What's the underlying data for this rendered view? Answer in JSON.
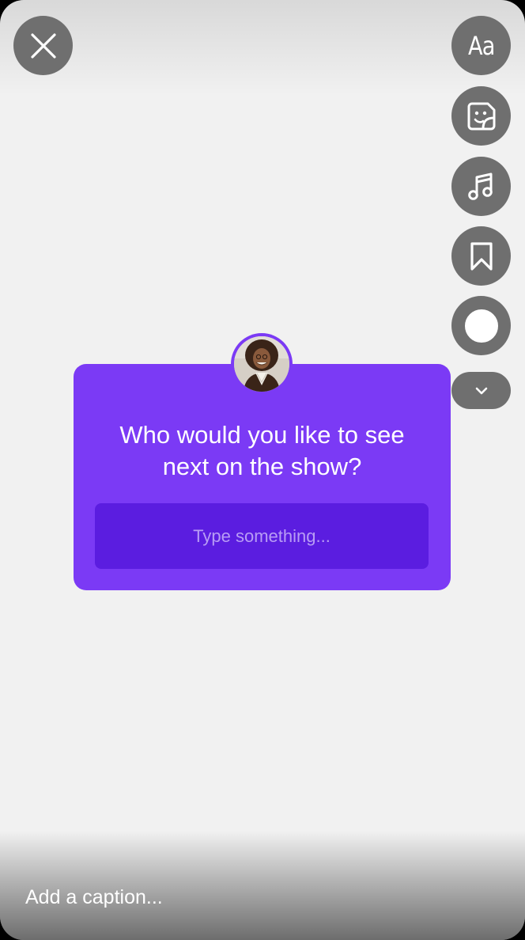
{
  "toolbar": {
    "close_icon": "close-icon",
    "text_tool_label": "Aa",
    "sticker_icon": "sticker-icon",
    "music_icon": "music-note-icon",
    "save_icon": "bookmark-icon",
    "effects_icon": "circle-icon",
    "more_icon": "chevron-down-icon"
  },
  "question_sticker": {
    "avatar": "profile-avatar",
    "question": "Who would you like to see next on the show?",
    "answer_placeholder": "Type something...",
    "color": "#7b3af5",
    "field_color": "#5b1de0"
  },
  "caption": {
    "placeholder": "Add a caption..."
  }
}
